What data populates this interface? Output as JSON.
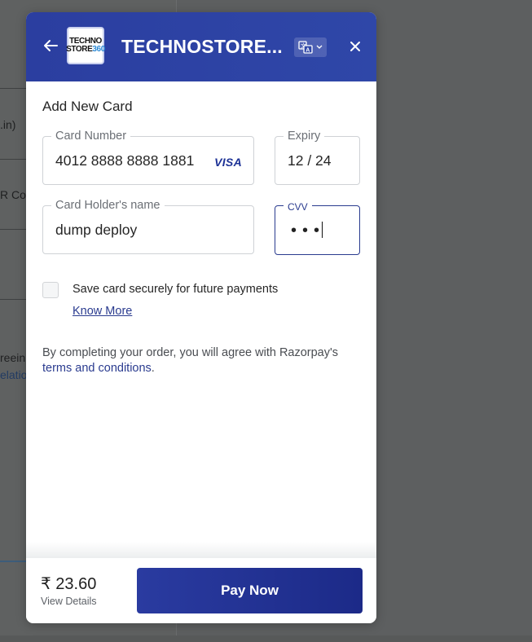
{
  "background_page": {
    "snippets": [
      ".in)",
      "R Co",
      "reein",
      "elatio"
    ]
  },
  "header": {
    "back_icon": "arrow-left-icon",
    "logo_line1": "TECHNO",
    "logo_line2": "STORE",
    "logo_suffix": "360",
    "merchant_name": "TECHNOSTORE...",
    "language_icon": "translate-icon",
    "close_icon": "close-icon",
    "color": "#2b3ea0"
  },
  "form": {
    "title": "Add New Card",
    "card_number": {
      "label": "Card Number",
      "value": "4012 8888 8888 1881",
      "brand": "VISA"
    },
    "expiry": {
      "label": "Expiry",
      "value": "12 / 24"
    },
    "holder_name": {
      "label": "Card Holder's name",
      "value": "dump deploy"
    },
    "cvv": {
      "label": "CVV",
      "value": "•••"
    },
    "save_card": {
      "label": "Save card securely for future payments",
      "checked": false
    },
    "know_more": "Know More",
    "terms_prefix": "By completing your order, you will agree with Razorpay's ",
    "terms_link": "terms and conditions",
    "terms_suffix": "."
  },
  "footer": {
    "amount": "₹ 23.60",
    "view_details": "View Details",
    "pay_button": "Pay Now"
  }
}
